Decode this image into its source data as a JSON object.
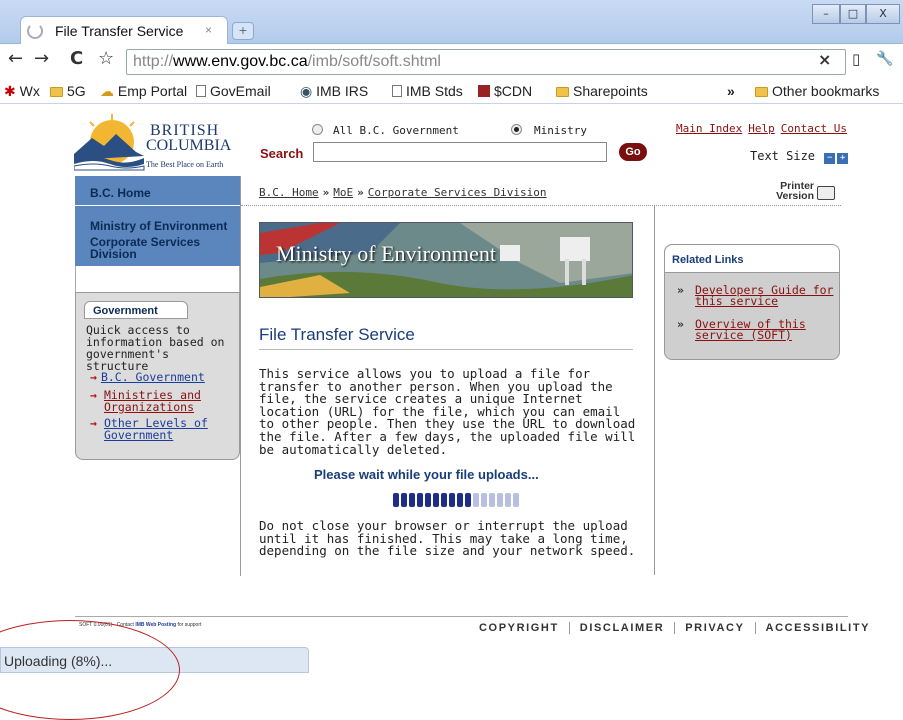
{
  "browser": {
    "tab_title": "File Transfer Service",
    "tab_close": "×",
    "new_tab": "+",
    "url_prefix": "http://",
    "url_domain": "www.env.gov.bc.ca",
    "url_path": "/imb/soft/soft.shtml",
    "window_minimize": "–",
    "window_maximize": "□",
    "window_close": "X",
    "nav_back": "←",
    "nav_forward": "→",
    "reload": "C",
    "star": "☆",
    "stop": "×",
    "page_menu": "▯",
    "wrench_menu": "🔧"
  },
  "bookmarks": [
    "Wx",
    "5G",
    "Emp Portal",
    "GovEmail",
    "IMB IRS",
    "IMB Stds",
    "$CDN",
    "Sharepoints"
  ],
  "bookmarks_more": "»",
  "bookmarks_other": "Other bookmarks",
  "logo": {
    "line1": "BRITISH",
    "line2": "COLUMBIA",
    "tagline": "The Best Place on Earth"
  },
  "search": {
    "opt_all": "All B.C. Government",
    "opt_ministry": "Ministry",
    "label": "Search",
    "value": "",
    "go": "Go"
  },
  "toplinks": [
    "Main Index",
    "Help",
    "Contact Us"
  ],
  "text_size": "Text Size",
  "text_size_minus": "−",
  "text_size_plus": "+",
  "sidebar": {
    "home": "B.C. Home",
    "ministry": "Ministry of Environment",
    "division": "Corporate Services Division"
  },
  "gov": {
    "tab": "Government",
    "desc": "Quick access to information based on government's structure",
    "links": [
      "B.C. Government",
      "Ministries and Organizations",
      "Other Levels of Government"
    ]
  },
  "breadcrumb": [
    "B.C. Home",
    "MoE",
    "Corporate Services Division"
  ],
  "breadcrumb_sep": "»",
  "printer": "Printer Version",
  "banner_text": "Ministry of Environment",
  "page_title": "File Transfer Service",
  "intro": "This service allows you to upload a file for transfer to another person. When you upload the file, the service creates a unique Internet location (URL) for the file, which you can email to other people. Then they use the URL to download the file. After a few days, the uploaded file will be automatically deleted.",
  "wait_msg": "Please wait while your file uploads...",
  "progress": {
    "filled": 10,
    "total": 16
  },
  "warn": "Do not close your browser or interrupt the upload until it has finished. This may take a long time, depending on the file size and your network speed.",
  "related": {
    "title": "Related Links",
    "links": [
      "Developers Guide for this service",
      "Overview of this service (SOFT)"
    ]
  },
  "footer": {
    "small_prefix": "SOFT 0.00(01) - Contact",
    "small_link": "IMB Web Posting",
    "small_suffix": "for support",
    "links": [
      "COPYRIGHT",
      "DISCLAIMER",
      "PRIVACY",
      "ACCESSIBILITY"
    ]
  },
  "status": "Uploading (8%)...",
  "colors": {
    "accent_red": "#8a1010",
    "nav_blue": "#5a86bd",
    "progress_blue": "#1f2d8a"
  }
}
